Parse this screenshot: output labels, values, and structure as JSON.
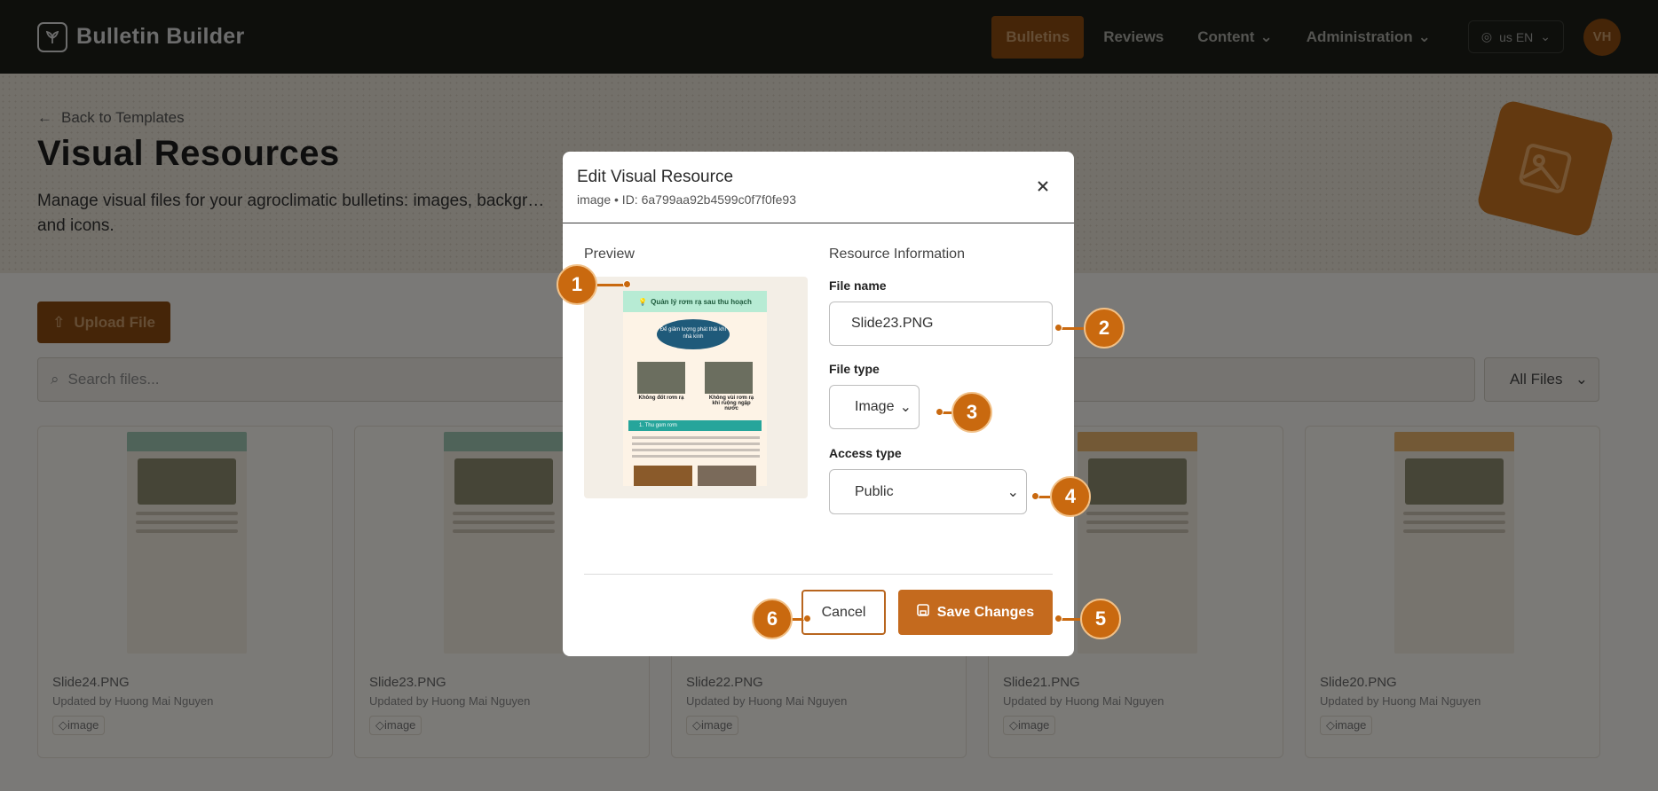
{
  "nav": {
    "brand": "Bulletin Builder",
    "links": [
      "Bulletins",
      "Reviews",
      "Content",
      "Administration"
    ],
    "lang": "us EN",
    "avatar": "VH"
  },
  "hero": {
    "back": "Back to Templates",
    "title": "Visual Resources",
    "description": "Manage visual files for your agroclimatic bulletins: images, backgr… and icons."
  },
  "toolbar": {
    "upload": "Upload File",
    "search_placeholder": "Search files...",
    "filter": "All Files"
  },
  "cards": [
    {
      "name": "Slide24.PNG",
      "meta": "Updated by Huong Mai Nguyen",
      "tag": "image"
    },
    {
      "name": "Slide23.PNG",
      "meta": "Updated by Huong Mai Nguyen",
      "tag": "image"
    },
    {
      "name": "Slide22.PNG",
      "meta": "Updated by Huong Mai Nguyen",
      "tag": "image"
    },
    {
      "name": "Slide21.PNG",
      "meta": "Updated by Huong Mai Nguyen",
      "tag": "image"
    },
    {
      "name": "Slide20.PNG",
      "meta": "Updated by Huong Mai Nguyen",
      "tag": "image"
    }
  ],
  "modal": {
    "title": "Edit Visual Resource",
    "subtitle": "image • ID: 6a799aa92b4599c0f7f0fe93",
    "preview_label": "Preview",
    "info_label": "Resource Information",
    "file_name_label": "File name",
    "file_name_value": "Slide23.PNG",
    "file_type_label": "File type",
    "file_type_value": "Image",
    "access_type_label": "Access type",
    "access_type_value": "Public",
    "cancel": "Cancel",
    "save": "Save Changes",
    "slide": {
      "title": "Quản lý rơm rạ sau thu hoạch",
      "bubble": "Để giảm lượng phát thải khí nhà kính",
      "cap_left": "Không đốt rơm rạ",
      "cap_right": "Không vùi rơm rạ khi ruộng ngập nước",
      "band": "1. Thu gom rơm"
    }
  },
  "callouts": [
    "1",
    "2",
    "3",
    "4",
    "5",
    "6"
  ]
}
